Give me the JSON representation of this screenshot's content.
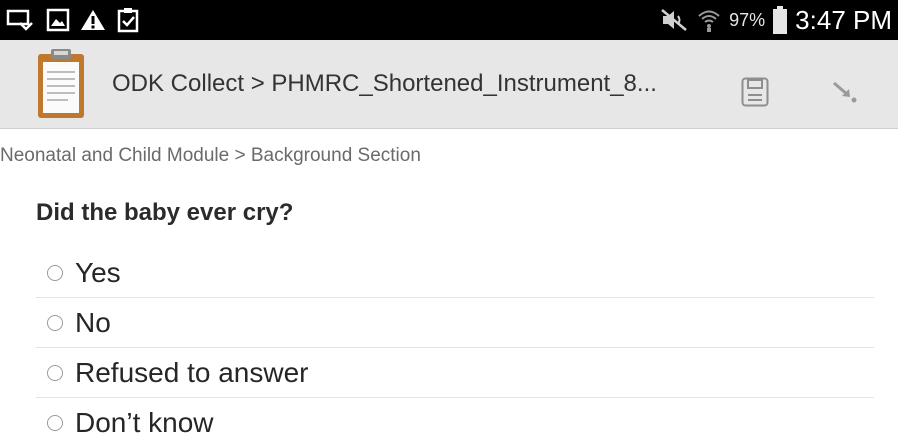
{
  "status_bar": {
    "left_icons": [
      "cast-icon",
      "image-icon",
      "warning-icon",
      "clipboard-check-icon"
    ],
    "right_icons": [
      "mute-icon",
      "wifi-icon",
      "battery-icon"
    ],
    "battery": "97%",
    "time": "3:47 PM"
  },
  "action_bar": {
    "app_icon": "clipboard-icon",
    "title": "ODK Collect > PHMRC_Shortened_Instrument_8...",
    "save_icon": "save-icon",
    "jump_icon": "jump-arrow-icon"
  },
  "form": {
    "breadcrumb": "Neonatal and Child Module > Background Section",
    "question": "Did the baby ever cry?",
    "options": [
      {
        "label": "Yes",
        "selected": false
      },
      {
        "label": "No",
        "selected": false
      },
      {
        "label": "Refused to answer",
        "selected": false
      },
      {
        "label": "Don’t know",
        "selected": false
      }
    ]
  },
  "colors": {
    "status_bar_bg": "#000000",
    "action_bar_bg": "#e7e7e7",
    "text_primary": "#262626",
    "text_secondary": "#6a6a6a"
  }
}
